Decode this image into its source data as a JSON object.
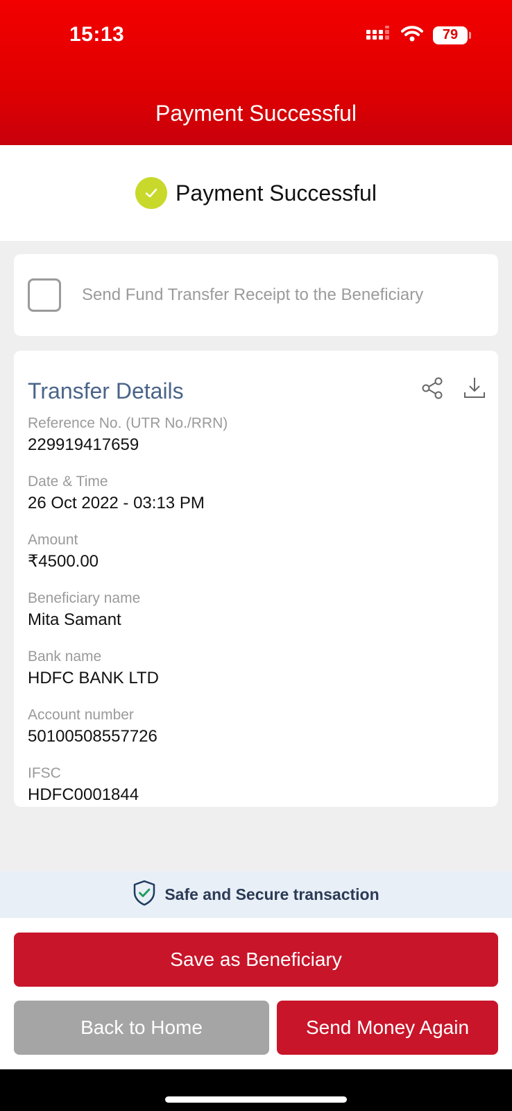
{
  "status_bar": {
    "time": "15:13",
    "battery": "79"
  },
  "header": {
    "title": "Payment Successful"
  },
  "success": {
    "message": "Payment Successful"
  },
  "receipt_option": {
    "label": "Send Fund Transfer Receipt to the Beneficiary",
    "checked": false
  },
  "details": {
    "title": "Transfer Details",
    "fields": [
      {
        "label": "Reference No. (UTR No./RRN)",
        "value": "229919417659"
      },
      {
        "label": "Date & Time",
        "value": "26 Oct 2022 - 03:13 PM"
      },
      {
        "label": "Amount",
        "value": "₹4500.00"
      },
      {
        "label": "Beneficiary name",
        "value": "Mita Samant"
      },
      {
        "label": "Bank name",
        "value": "HDFC BANK LTD"
      },
      {
        "label": "Account number",
        "value": "50100508557726"
      },
      {
        "label": "IFSC",
        "value": "HDFC0001844"
      }
    ]
  },
  "secure": {
    "text": "Safe and Secure transaction"
  },
  "buttons": {
    "save_beneficiary": "Save as Beneficiary",
    "back_home": "Back to Home",
    "send_again": "Send Money Again"
  },
  "colors": {
    "brand_red": "#e00000",
    "button_red": "#c8152a",
    "success_green": "#c9d92b"
  },
  "icons": [
    "signal-icon",
    "wifi-icon",
    "battery-icon",
    "check-circle-icon",
    "share-icon",
    "download-icon",
    "shield-check-icon"
  ]
}
